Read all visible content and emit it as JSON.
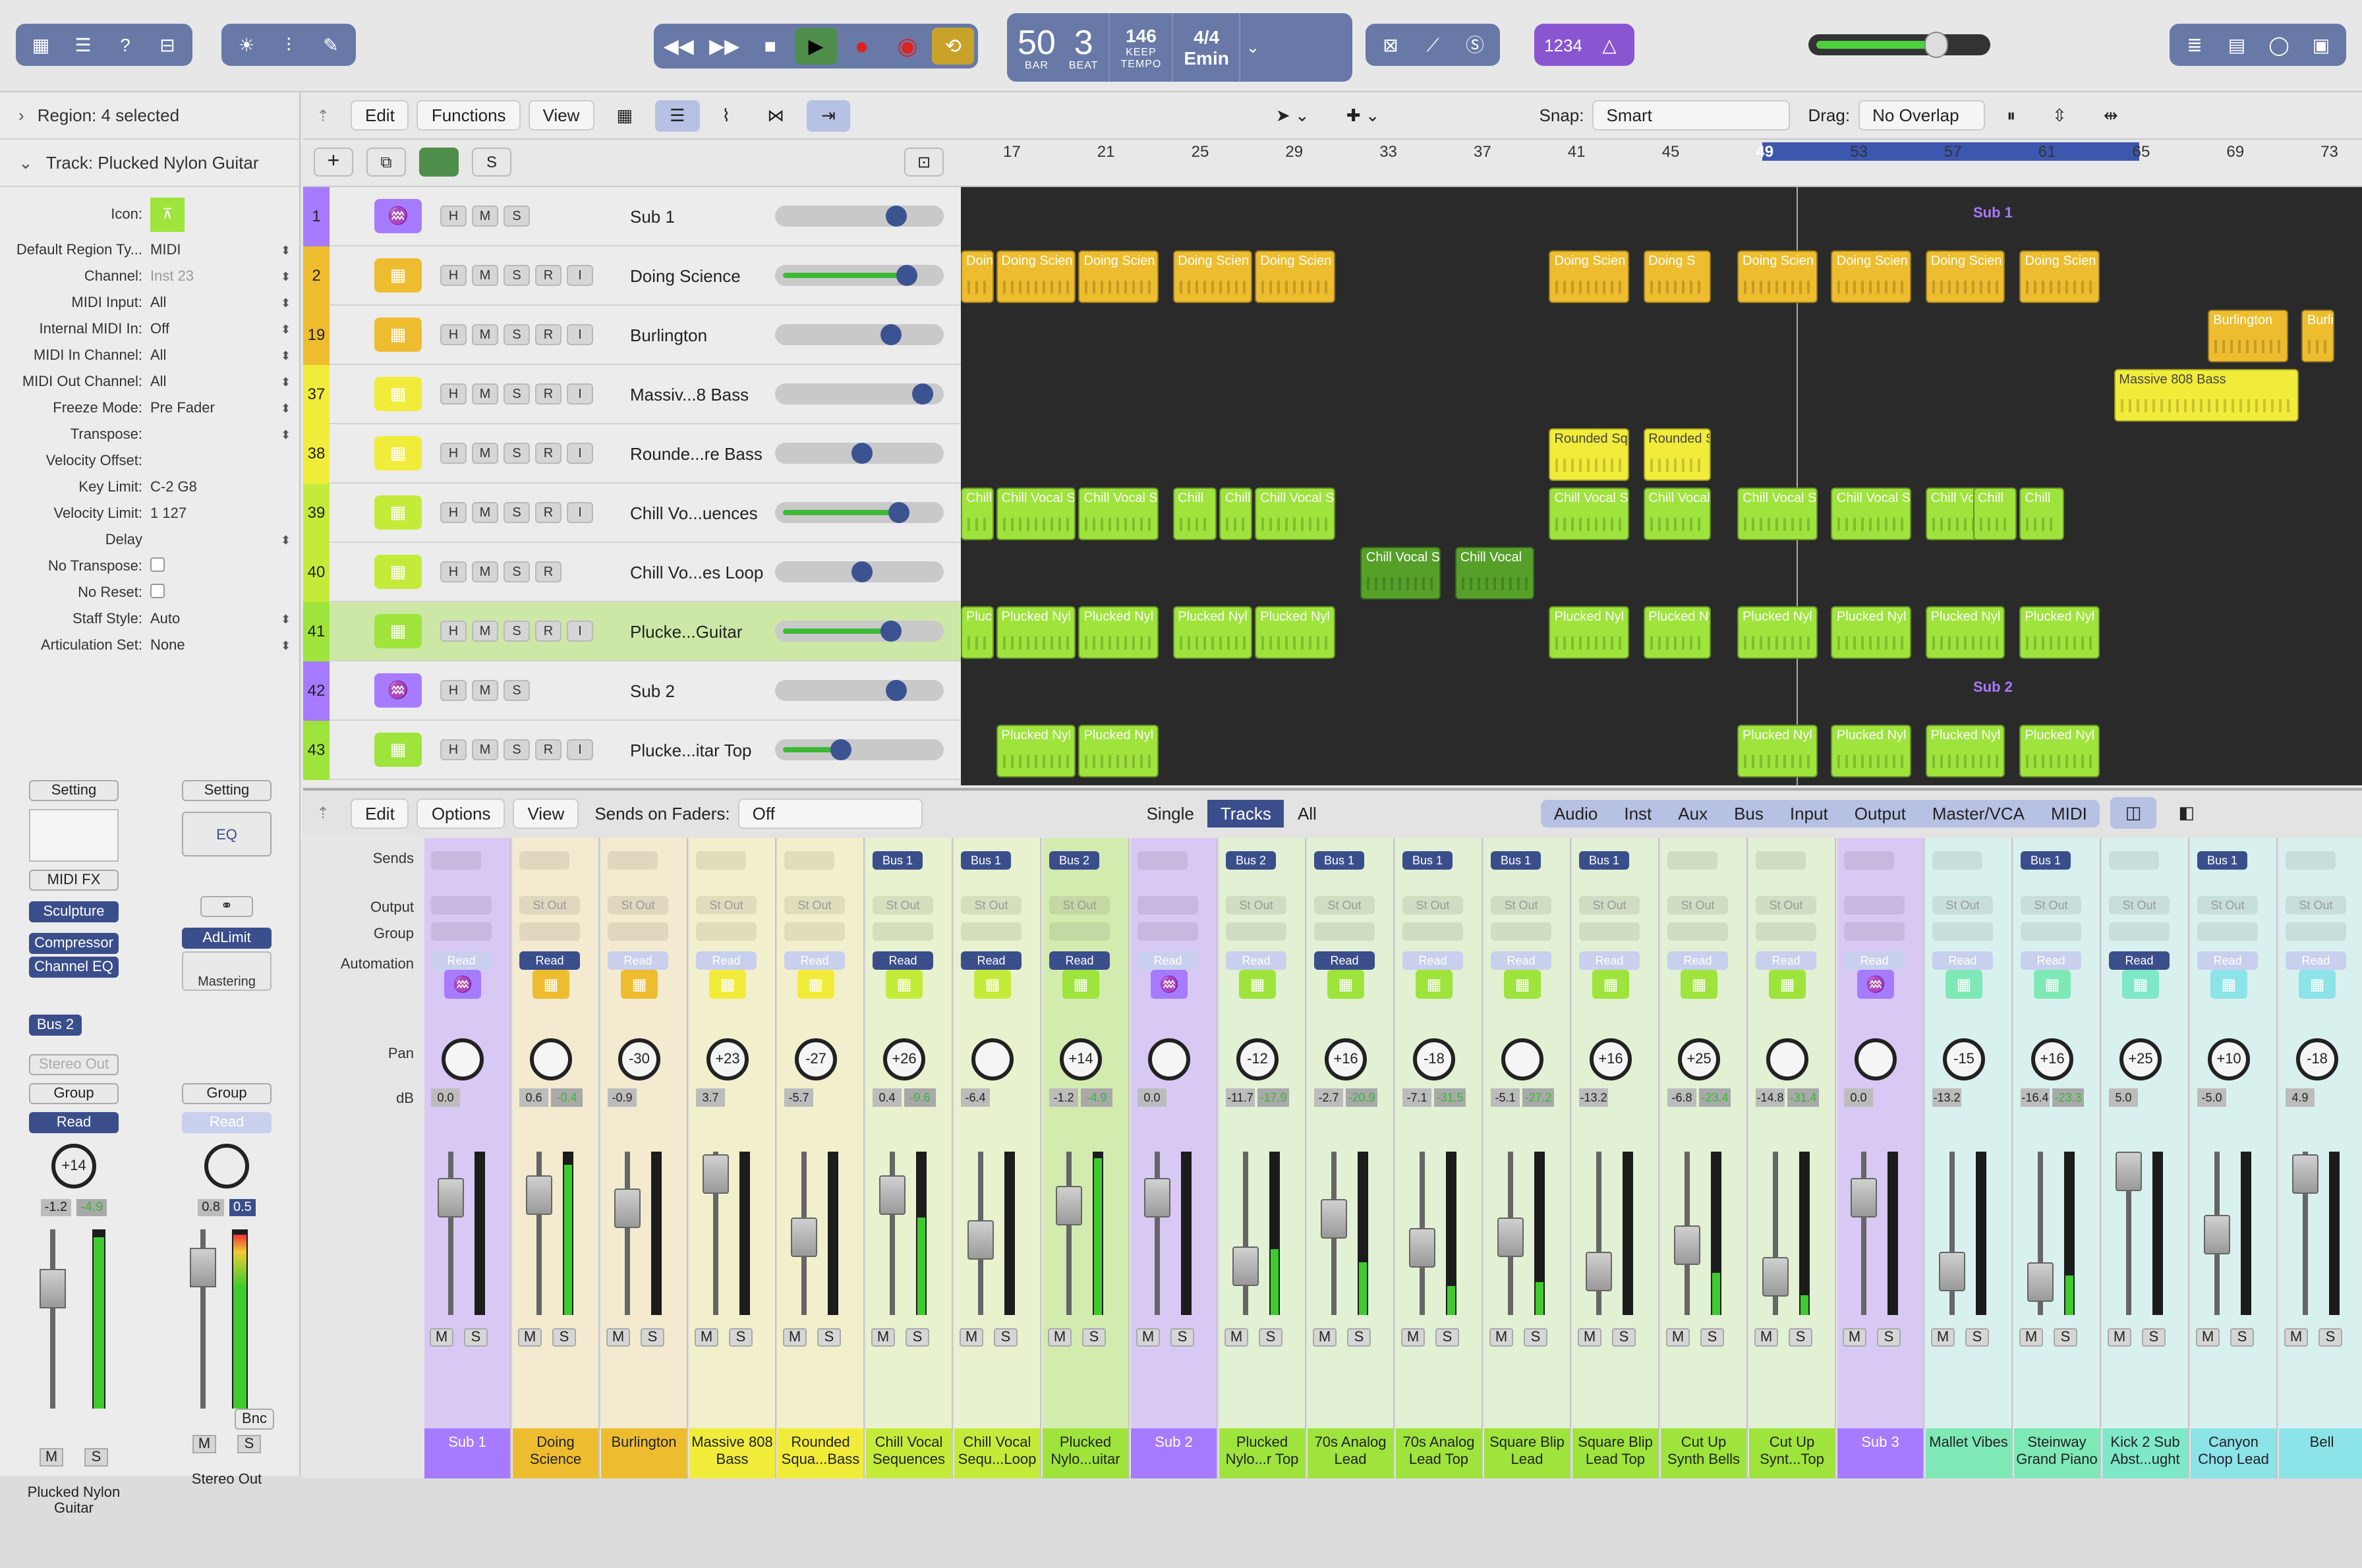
{
  "control_bar": {
    "lcd": {
      "bar": "50",
      "beat": "3",
      "bar_label": "BAR",
      "beat_label": "BEAT",
      "tempo": "146",
      "tempo_mode": "KEEP",
      "tempo_label": "TEMPO",
      "signature": "4/4",
      "key": "Emin"
    },
    "count_in": "1234"
  },
  "inspector": {
    "region_header": "Region: 4 selected",
    "track_header": "Track: Plucked Nylon Guitar",
    "params": [
      {
        "label": "Icon:",
        "value": ""
      },
      {
        "label": "Default Region Ty...",
        "value": "MIDI"
      },
      {
        "label": "Channel:",
        "value": "Inst 23"
      },
      {
        "label": "MIDI Input:",
        "value": "All"
      },
      {
        "label": "Internal MIDI In:",
        "value": "Off"
      },
      {
        "label": "MIDI In Channel:",
        "value": "All"
      },
      {
        "label": "MIDI Out Channel:",
        "value": "All"
      },
      {
        "label": "Freeze Mode:",
        "value": "Pre Fader"
      },
      {
        "label": "Transpose:",
        "value": ""
      },
      {
        "label": "Velocity Offset:",
        "value": ""
      },
      {
        "label": "Key Limit:",
        "value": "C-2  G8"
      },
      {
        "label": "Velocity Limit:",
        "value": "1  127"
      },
      {
        "label": "Delay",
        "value": ""
      },
      {
        "label": "No Transpose:",
        "value": ""
      },
      {
        "label": "No Reset:",
        "value": ""
      },
      {
        "label": "Staff Style:",
        "value": "Auto"
      },
      {
        "label": "Articulation Set:",
        "value": "None"
      }
    ],
    "strip_left": {
      "setting": "Setting",
      "midi_fx": "MIDI FX",
      "instrument": "Sculpture",
      "fx": [
        "Compressor",
        "Channel EQ"
      ],
      "send": "Bus 2",
      "output": "Stereo Out",
      "group": "Group",
      "automation": "Read",
      "pan": "+14",
      "db_a": "-1.2",
      "db_b": "-4.9",
      "name": "Plucked Nylon Guitar"
    },
    "strip_right": {
      "setting": "Setting",
      "eq": "EQ",
      "fx": "AdLimit",
      "mastering": "Mastering",
      "group": "Group",
      "automation": "Read",
      "db_a": "0.8",
      "db_b": "0.5",
      "bnc": "Bnc",
      "name": "Stereo Out"
    },
    "mute": "M",
    "solo": "S"
  },
  "tracks_toolbar": {
    "edit": "Edit",
    "functions": "Functions",
    "view": "View",
    "snap_label": "Snap:",
    "snap_value": "Smart",
    "drag_label": "Drag:",
    "drag_value": "No Overlap"
  },
  "ruler": [
    "17",
    "21",
    "25",
    "29",
    "33",
    "37",
    "41",
    "45",
    "49",
    "53",
    "57",
    "61",
    "65",
    "69",
    "73"
  ],
  "tracks": [
    {
      "num": "1",
      "name": "Sub 1",
      "color": "#a77bff",
      "rib": false
    },
    {
      "num": "2",
      "name": "Doing Science",
      "color": "#eebd2f",
      "rib": true
    },
    {
      "num": "19",
      "name": "Burlington",
      "color": "#eebd2f",
      "rib": true
    },
    {
      "num": "37",
      "name": "Massiv...8 Bass",
      "color": "#f1ec3a",
      "rib": true
    },
    {
      "num": "38",
      "name": "Rounde...re Bass",
      "color": "#f1ec3a",
      "rib": true
    },
    {
      "num": "39",
      "name": "Chill Vo...uences",
      "color": "#c5eb3a",
      "rib": true
    },
    {
      "num": "40",
      "name": "Chill Vo...es Loop",
      "color": "#c5eb3a",
      "rib": false
    },
    {
      "num": "41",
      "name": "Plucke...Guitar",
      "color": "#9ee43c",
      "rib": true
    },
    {
      "num": "42",
      "name": "Sub 2",
      "color": "#a77bff",
      "rib": false
    },
    {
      "num": "43",
      "name": "Plucke...itar Top",
      "color": "#9ee43c",
      "rib": true
    }
  ],
  "regions": {
    "doing_science": "Doing Scien",
    "doing_s": "Doing S",
    "burlington": "Burlington",
    "massive": "Massive 808 Bass",
    "rounded": "Rounded Sq",
    "chill_vocal_s": "Chill Vocal S",
    "chill_vocal": "Chill Vocal",
    "chill": "Chill",
    "plucked": "Plucked Nyl",
    "sub1": "Sub 1",
    "sub2": "Sub 2"
  },
  "mixer": {
    "edit": "Edit",
    "options": "Options",
    "view": "View",
    "sends_on_faders": "Sends on Faders:",
    "sends_value": "Off",
    "views": [
      "Single",
      "Tracks",
      "All"
    ],
    "filters": [
      "Audio",
      "Inst",
      "Aux",
      "Bus",
      "Input",
      "Output",
      "Master/VCA",
      "MIDI"
    ],
    "row_labels": {
      "sends": "Sends",
      "output": "Output",
      "group": "Group",
      "automation": "Automation",
      "pan": "Pan",
      "db": "dB"
    },
    "channels": [
      {
        "name": "Sub 1",
        "color": "#a77bff",
        "pan": "",
        "db1": "0.0",
        "db2": "",
        "send": "",
        "auto": "Read",
        "cap": 20,
        "meter": 0
      },
      {
        "name": "Doing Science",
        "color": "#eebd2f",
        "pan": "",
        "db1": "0.6",
        "db2": "-0.4",
        "send": "",
        "auto": "Read",
        "cap": 18,
        "meter": 92
      },
      {
        "name": "Burlington",
        "color": "#eebd2f",
        "pan": "-30",
        "db1": "-0.9",
        "db2": "",
        "send": "",
        "auto": "Read",
        "cap": 28,
        "meter": 0
      },
      {
        "name": "Massive 808 Bass",
        "color": "#f1ec3a",
        "pan": "+23",
        "db1": "3.7",
        "db2": "",
        "send": "",
        "auto": "Read",
        "cap": 2,
        "meter": 0
      },
      {
        "name": "Rounded Squa...Bass",
        "color": "#f1ec3a",
        "pan": "-27",
        "db1": "-5.7",
        "db2": "",
        "send": "",
        "auto": "Read",
        "cap": 50,
        "meter": 0
      },
      {
        "name": "Chill Vocal Sequences",
        "color": "#c5eb3a",
        "pan": "+26",
        "db1": "0.4",
        "db2": "-9.6",
        "send": "Bus 1",
        "auto": "Read",
        "cap": 18,
        "meter": 60
      },
      {
        "name": "Chill Vocal Sequ...Loop",
        "color": "#c5eb3a",
        "pan": "",
        "db1": "-6.4",
        "db2": "",
        "send": "Bus 1",
        "auto": "Read",
        "cap": 52,
        "meter": 0
      },
      {
        "name": "Plucked Nylo...uitar",
        "color": "#9ee43c",
        "pan": "+14",
        "db1": "-1.2",
        "db2": "-4.9",
        "send": "Bus 2",
        "auto": "Read",
        "cap": 26,
        "meter": 96
      },
      {
        "name": "Sub 2",
        "color": "#a77bff",
        "pan": "",
        "db1": "0.0",
        "db2": "",
        "send": "",
        "auto": "Read",
        "cap": 20,
        "meter": 0
      },
      {
        "name": "Plucked Nylo...r Top",
        "color": "#9ee43c",
        "pan": "-12",
        "db1": "-11.7",
        "db2": "-17.9",
        "send": "Bus 2",
        "auto": "Read",
        "cap": 72,
        "meter": 40
      },
      {
        "name": "70s Analog Lead",
        "color": "#9ee43c",
        "pan": "+16",
        "db1": "-2.7",
        "db2": "-20.9",
        "send": "Bus 1",
        "auto": "Read",
        "cap": 36,
        "meter": 32
      },
      {
        "name": "70s Analog Lead Top",
        "color": "#9ee43c",
        "pan": "-18",
        "db1": "-7.1",
        "db2": "-31.5",
        "send": "Bus 1",
        "auto": "Read",
        "cap": 58,
        "meter": 18
      },
      {
        "name": "Square Blip Lead",
        "color": "#9ee43c",
        "pan": "",
        "db1": "-5.1",
        "db2": "-27.2",
        "send": "Bus 1",
        "auto": "Read",
        "cap": 50,
        "meter": 20
      },
      {
        "name": "Square Blip Lead Top",
        "color": "#9ee43c",
        "pan": "+16",
        "db1": "-13.2",
        "db2": "",
        "send": "Bus 1",
        "auto": "Read",
        "cap": 76,
        "meter": 0
      },
      {
        "name": "Cut Up Synth Bells",
        "color": "#9ee43c",
        "pan": "+25",
        "db1": "-6.8",
        "db2": "-23.4",
        "send": "",
        "auto": "Read",
        "cap": 56,
        "meter": 26
      },
      {
        "name": "Cut Up Synt...Top",
        "color": "#9ee43c",
        "pan": "",
        "db1": "-14.8",
        "db2": "-31.4",
        "send": "",
        "auto": "Read",
        "cap": 80,
        "meter": 12
      },
      {
        "name": "Sub 3",
        "color": "#a77bff",
        "pan": "",
        "db1": "0.0",
        "db2": "",
        "send": "",
        "auto": "Read",
        "cap": 20,
        "meter": 0
      },
      {
        "name": "Mallet Vibes",
        "color": "#7fe8b7",
        "pan": "-15",
        "db1": "-13.2",
        "db2": "",
        "send": "",
        "auto": "Read",
        "cap": 76,
        "meter": 0
      },
      {
        "name": "Steinway Grand Piano",
        "color": "#7fe8b7",
        "pan": "+16",
        "db1": "-16.4",
        "db2": "-23.3",
        "send": "Bus 1",
        "auto": "Read",
        "cap": 84,
        "meter": 24
      },
      {
        "name": "Kick 2 Sub Abst...ught",
        "color": "#7fe8c9",
        "pan": "+25",
        "db1": "5.0",
        "db2": "",
        "send": "",
        "auto": "Read",
        "cap": 0,
        "meter": 0
      },
      {
        "name": "Canyon Chop Lead",
        "color": "#8ce3e8",
        "pan": "+10",
        "db1": "-5.0",
        "db2": "",
        "send": "Bus 1",
        "auto": "Read",
        "cap": 48,
        "meter": 0
      },
      {
        "name": "Bell",
        "color": "#8ce3e8",
        "pan": "-18",
        "db1": "4.9",
        "db2": "",
        "send": "",
        "auto": "Read",
        "cap": 2,
        "meter": 0
      }
    ],
    "output_label": "St Out",
    "mute": "M",
    "solo": "S"
  }
}
